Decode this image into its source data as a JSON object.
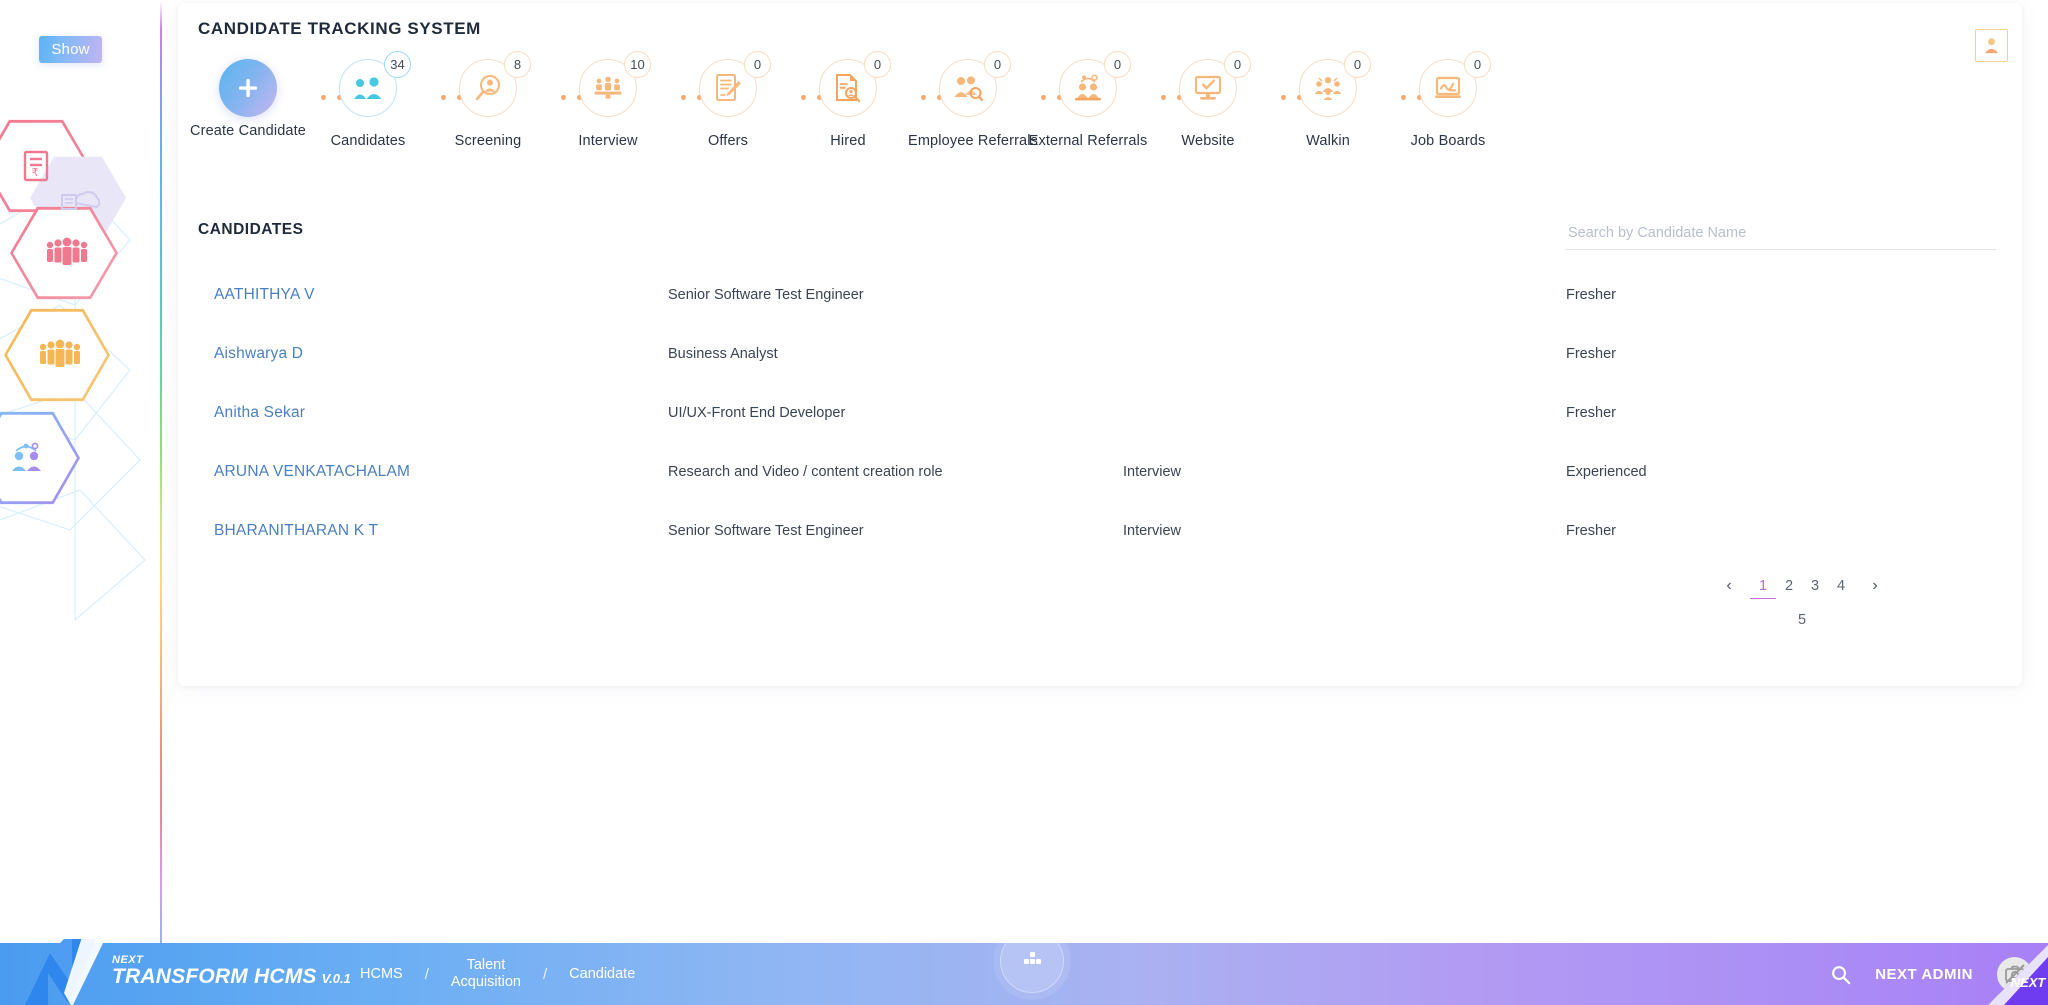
{
  "sidebar": {
    "show_button": "Show",
    "decor_icons": [
      "invoice-rupee-icon",
      "cloud-document-icon",
      "people-group-pink-icon",
      "people-group-orange-icon",
      "interview-pair-icon"
    ]
  },
  "card": {
    "title": "CANDIDATE TRACKING SYSTEM",
    "user_badge_icon": "user-icon"
  },
  "pipeline": {
    "steps": [
      {
        "label": "Create Candidate",
        "count": null,
        "icon": "plus-icon",
        "style": "create"
      },
      {
        "label": "Candidates",
        "count": "34",
        "icon": "people-icon",
        "style": "blue"
      },
      {
        "label": "Screening",
        "count": "8",
        "icon": "magnifier-person-icon",
        "style": "orange"
      },
      {
        "label": "Interview",
        "count": "10",
        "icon": "interview-table-icon",
        "style": "orange"
      },
      {
        "label": "Offers",
        "count": "0",
        "icon": "document-pen-icon",
        "style": "orange"
      },
      {
        "label": "Hired",
        "count": "0",
        "icon": "document-search-icon",
        "style": "orange"
      },
      {
        "label": "Employee Referrals",
        "count": "0",
        "icon": "people-search-icon",
        "style": "orange"
      },
      {
        "label": "External Referrals",
        "count": "0",
        "icon": "referral-pair-icon",
        "style": "orange"
      },
      {
        "label": "Website",
        "count": "0",
        "icon": "monitor-check-icon",
        "style": "orange"
      },
      {
        "label": "Walkin",
        "count": "0",
        "icon": "walkin-group-icon",
        "style": "orange"
      },
      {
        "label": "Job Boards",
        "count": "0",
        "icon": "chart-board-icon",
        "style": "orange"
      }
    ]
  },
  "candidates": {
    "section_title": "CANDIDATES",
    "search": {
      "value": "",
      "placeholder": "Search by Candidate Name",
      "icon": "search-icon"
    },
    "rows": [
      {
        "name": "AATHITHYA V",
        "role": "Senior Software Test Engineer",
        "stage": "",
        "type": "Fresher",
        "action_icon": "edit-icon"
      },
      {
        "name": "Aishwarya D",
        "role": "Business Analyst",
        "stage": "",
        "type": "Fresher",
        "action_icon": "edit-icon"
      },
      {
        "name": "Anitha Sekar",
        "role": "UI/UX-Front End Developer",
        "stage": "",
        "type": "Fresher",
        "action_icon": "edit-icon"
      },
      {
        "name": "ARUNA VENKATACHALAM",
        "role": "Research and Video / content creation role",
        "stage": "Interview",
        "type": "Experienced",
        "action_icon": "edit-icon"
      },
      {
        "name": "BHARANITHARAN K T",
        "role": "Senior Software Test Engineer",
        "stage": "Interview",
        "type": "Fresher",
        "action_icon": "edit-icon"
      }
    ]
  },
  "pagination": {
    "prev_icon": "chevron-left-icon",
    "next_icon": "chevron-right-icon",
    "pages": [
      "1",
      "2",
      "3",
      "4",
      "5"
    ],
    "active": "1"
  },
  "footer": {
    "logo_icon": "next-n-logo",
    "brand_small": "NEXT",
    "brand_big": "TRANSFORM HCMS",
    "brand_version": "V.0.1",
    "breadcrumbs": [
      "HCMS",
      "Talent\nAcquisition",
      "Candidate"
    ],
    "separator": "/",
    "apps_button_icon": "apps-grid-icon",
    "search_icon": "search-icon",
    "admin_label": "NEXT ADMIN",
    "avatar_icon": "no-camera-icon",
    "corner_label": "NEXT"
  },
  "colors": {
    "accent_blue": "#4a9cf0",
    "accent_purple": "#a87ff7",
    "link_blue": "#4a7fc1",
    "orange": "#f7ab72",
    "edit_red": "#ef6b6b",
    "pager_active": "#b06bd8"
  }
}
